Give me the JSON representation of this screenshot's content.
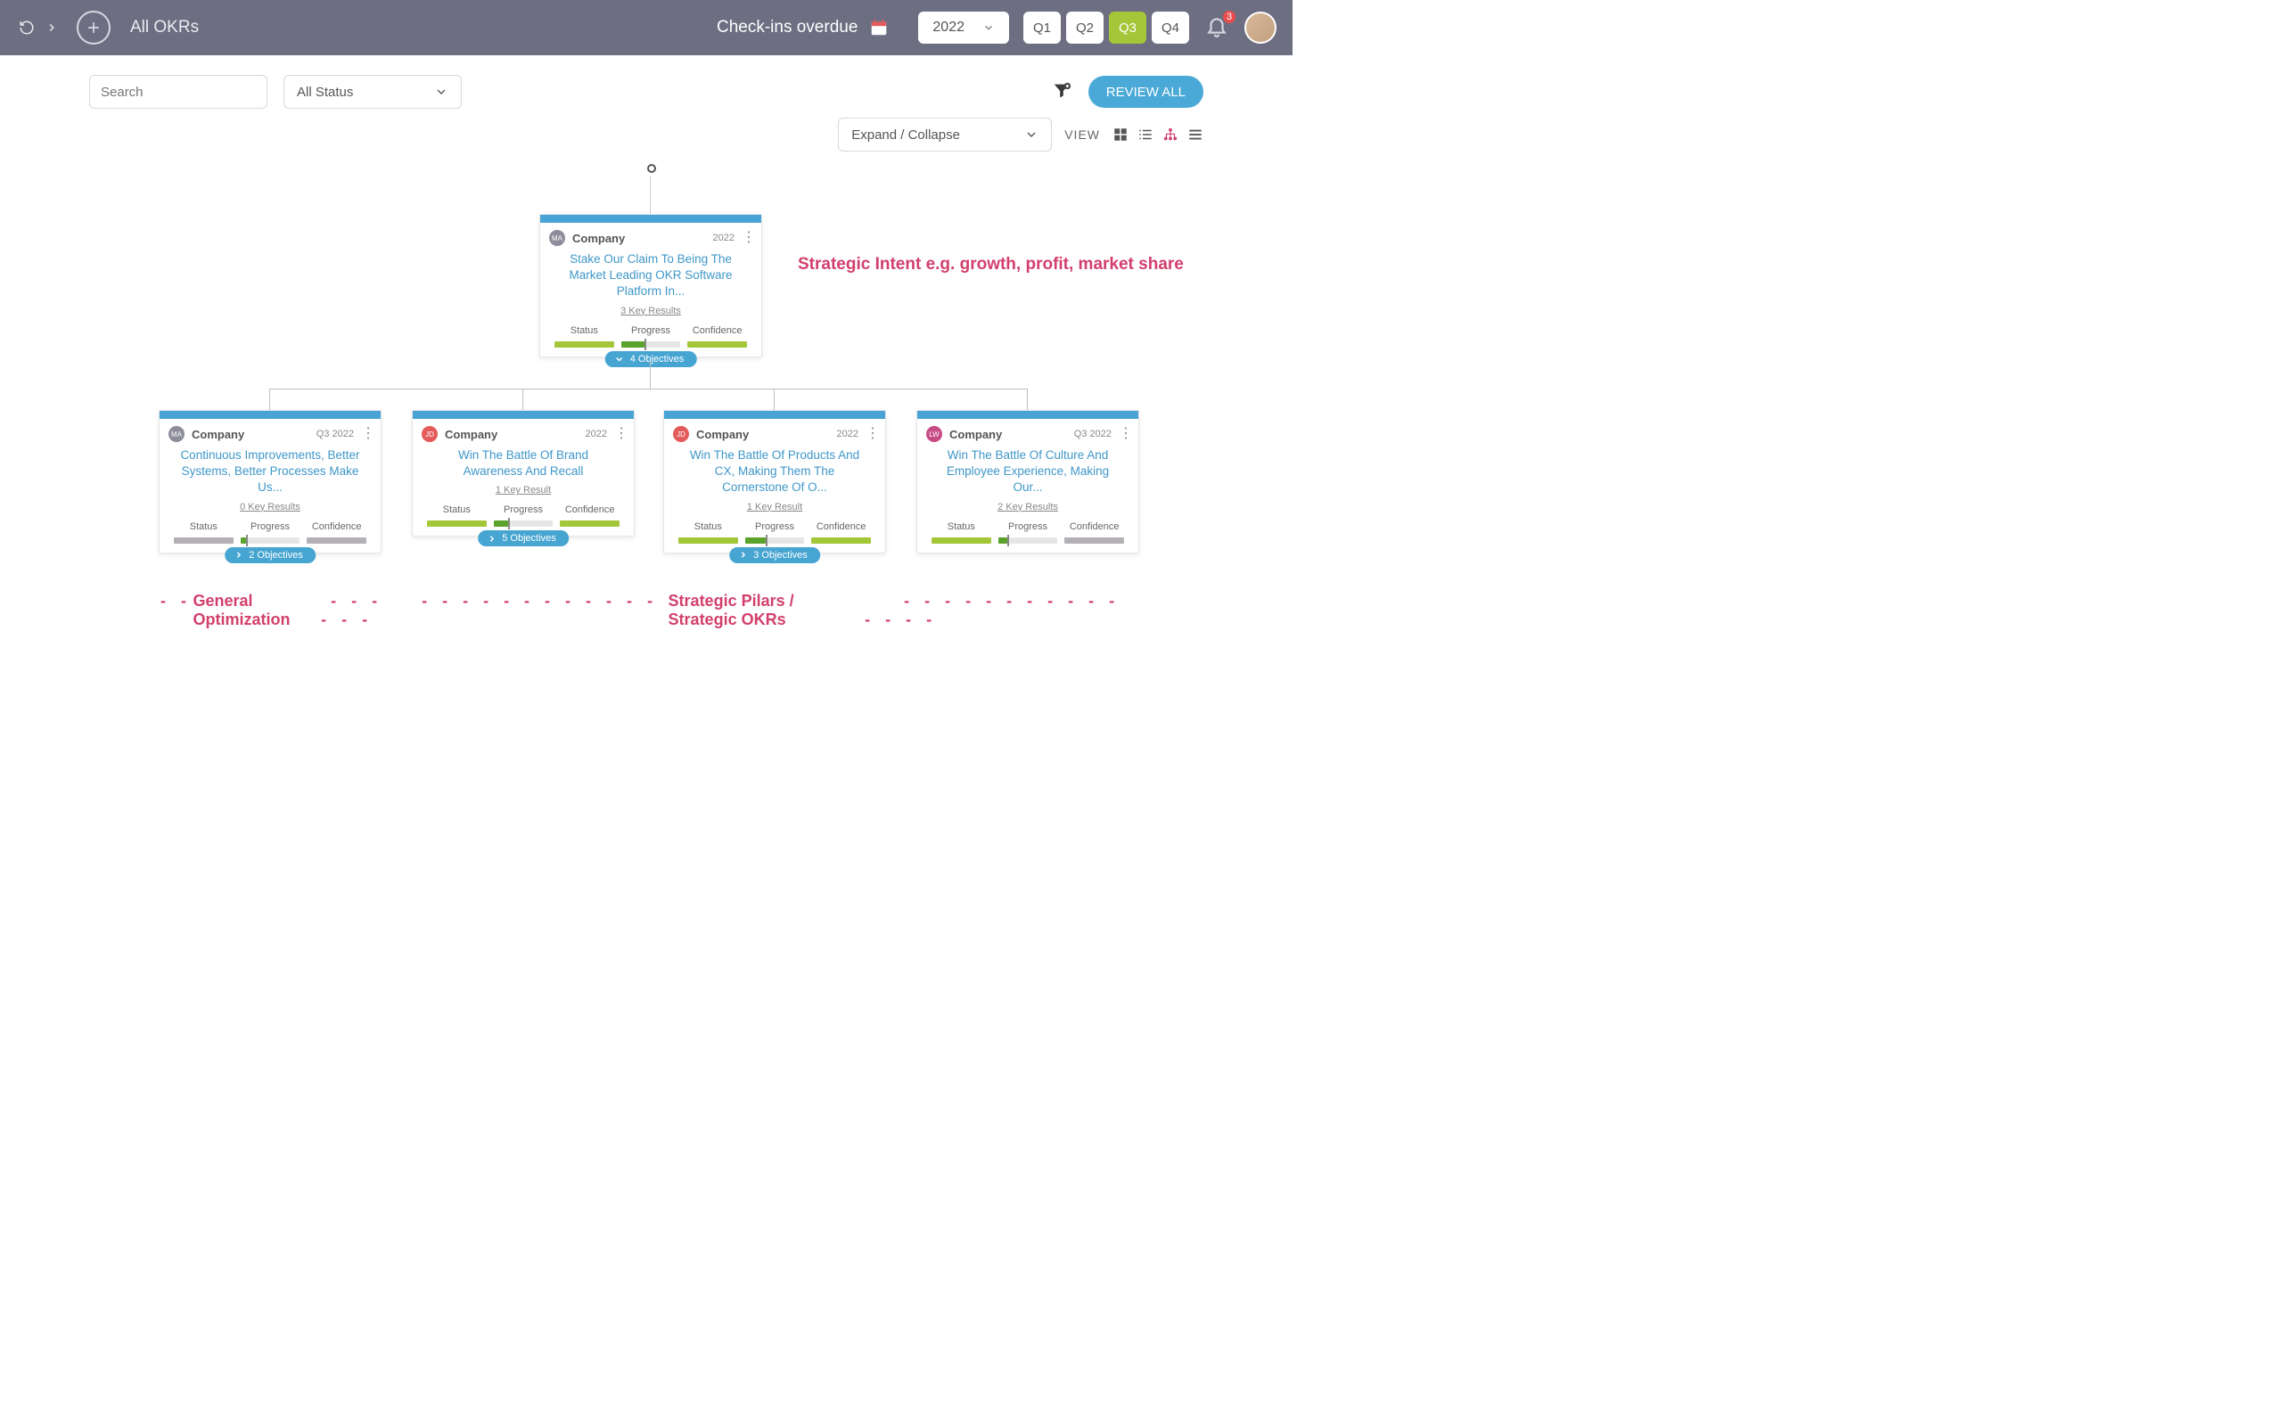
{
  "header": {
    "title": "All OKRs",
    "overdue": "Check-ins overdue",
    "year": "2022",
    "quarters": [
      "Q1",
      "Q2",
      "Q3",
      "Q4"
    ],
    "active_quarter": "Q3",
    "notification_count": "3"
  },
  "controls": {
    "search_placeholder": "Search",
    "status_label": "All Status",
    "review_button": "REVIEW ALL",
    "expand_label": "Expand / Collapse",
    "view_label": "VIEW"
  },
  "root_card": {
    "avatar": "MA",
    "team": "Company",
    "period": "2022",
    "title": "Stake Our Claim To Being The Market Leading OKR Software Platform In...",
    "kr": "3 Key Results",
    "status_label": "Status",
    "progress_label": "Progress",
    "confidence_label": "Confidence",
    "progress_pct": 40,
    "pill": "4 Objectives"
  },
  "children": [
    {
      "avatar": "MA",
      "avatar_color": "gray",
      "team": "Company",
      "period": "Q3 2022",
      "title": "Continuous Improvements, Better Systems, Better Processes Make Us...",
      "kr": "0 Key Results",
      "progress_pct": 10,
      "status_color": "gray",
      "confidence_color": "gray",
      "pill": "2 Objectives",
      "has_pill": true
    },
    {
      "avatar": "JD",
      "avatar_color": "red",
      "team": "Company",
      "period": "2022",
      "title": "Win The Battle Of Brand Awareness And Recall",
      "kr": "1 Key Result",
      "progress_pct": 25,
      "status_color": "green",
      "confidence_color": "green",
      "pill": "5 Objectives",
      "has_pill": true
    },
    {
      "avatar": "JD",
      "avatar_color": "red",
      "team": "Company",
      "period": "2022",
      "title": "Win The Battle Of Products And CX, Making Them The Cornerstone Of O...",
      "kr": "1 Key Result",
      "progress_pct": 35,
      "status_color": "green",
      "confidence_color": "green",
      "pill": "3 Objectives",
      "has_pill": true
    },
    {
      "avatar": "LW",
      "avatar_color": "mag",
      "team": "Company",
      "period": "Q3 2022",
      "title": "Win The Battle Of Culture And Employee Experience, Making Our...",
      "kr": "2 Key Results",
      "progress_pct": 15,
      "status_color": "green",
      "confidence_color": "gray",
      "pill": "",
      "has_pill": false
    }
  ],
  "annotations": {
    "intent": "Strategic Intent e.g. growth, profit, market share",
    "opt": "General Optimization",
    "pillars": "Strategic Pilars / Strategic OKRs"
  }
}
